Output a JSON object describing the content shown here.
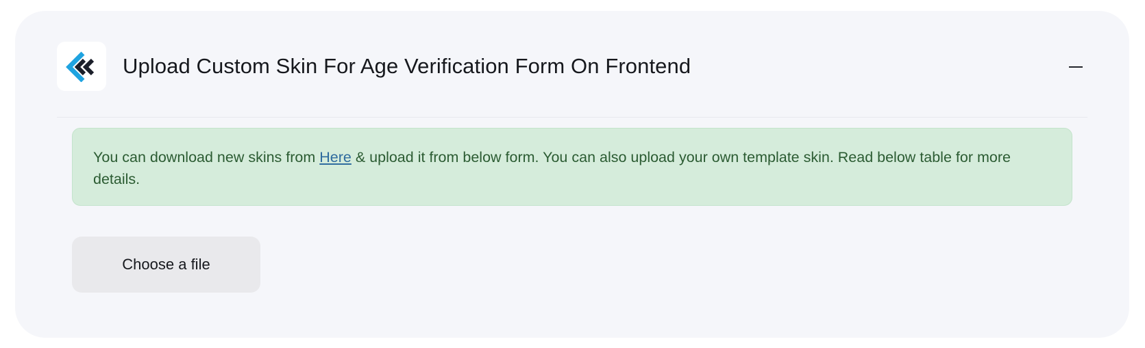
{
  "header": {
    "title": "Upload Custom Skin For Age Verification Form On Frontend",
    "logo_icon": "brand-logo-icon",
    "collapse_icon": "minus-icon"
  },
  "notice": {
    "text_before_link": "You can download new skins from ",
    "link_text": "Here",
    "text_after_link": " & upload it from below form. You can also upload your own template skin. Read below table for more details."
  },
  "upload": {
    "button_label": "Choose a file"
  },
  "colors": {
    "card_bg": "#f5f6fa",
    "notice_bg": "#d5ecdb",
    "notice_text": "#2b5b32",
    "link": "#2e6b9e",
    "logo_blue": "#1fa3e0",
    "logo_dark": "#1b1f2a"
  }
}
